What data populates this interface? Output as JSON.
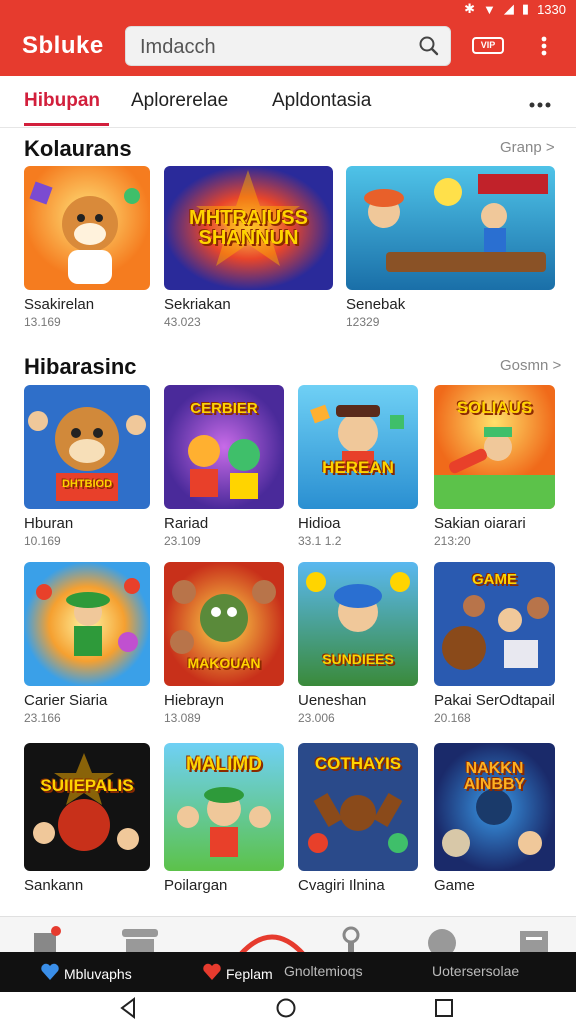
{
  "status": {
    "time": "1330"
  },
  "header": {
    "logo": "Sbluke",
    "search_placeholder": "Imdacch",
    "vip_label": "VIP",
    "brand_color": "#e63b2e"
  },
  "tabs": [
    {
      "label": "Hibupan",
      "active": true
    },
    {
      "label": "Aplorerelae"
    },
    {
      "label": "Apldontasia"
    }
  ],
  "sections": [
    {
      "title": "Kolaurans",
      "link": "Granp >",
      "items": [
        {
          "name": "Ssakirelan",
          "count": "13.169"
        },
        {
          "name": "Sekriakan",
          "count": "43.023",
          "banner": "MHTRAIUSS SHANNUN"
        },
        {
          "name": "Senebak",
          "count": "12329"
        }
      ]
    },
    {
      "title": "Hibarasinc",
      "link": "Gosmn >",
      "rows": [
        [
          {
            "name": "Hburan",
            "count": "10.169",
            "banner": "DHTBIOD"
          },
          {
            "name": "Rariad",
            "count": "23.109",
            "banner": "CERBIER"
          },
          {
            "name": "Hidioa",
            "count": "33.1 1.2",
            "banner": "HEREAN"
          },
          {
            "name": "Sakian oiarari",
            "count": "213:20",
            "banner": "SOLIAUS"
          }
        ],
        [
          {
            "name": "Carier Siaria",
            "count": "23.166"
          },
          {
            "name": "Hiebrayn",
            "count": "13.089",
            "banner": "MAKOUAN"
          },
          {
            "name": "Ueneshan",
            "count": "23.006",
            "banner": "SUNDIEES"
          },
          {
            "name": "Pakai SerOdtapail",
            "count": "20.168",
            "banner": "GAME"
          }
        ],
        [
          {
            "name": "Sankann",
            "count": "",
            "banner": "SUIIEPALIS"
          },
          {
            "name": "Poilargan",
            "count": "",
            "banner": "MALIMD"
          },
          {
            "name": "Cvagiri Ilnina",
            "count": "",
            "banner": "COTHAYIS"
          },
          {
            "name": "Game",
            "count": "",
            "banner": "NAKKN AINBBY"
          }
        ]
      ]
    }
  ],
  "bottom_bar": [
    {
      "label": "Mbluvaphs",
      "icon": "heart-icon"
    },
    {
      "label": "Feplam",
      "icon": "heart-icon"
    },
    {
      "label": "Gnoltemioqs"
    },
    {
      "label": "Uotersersolae"
    }
  ]
}
